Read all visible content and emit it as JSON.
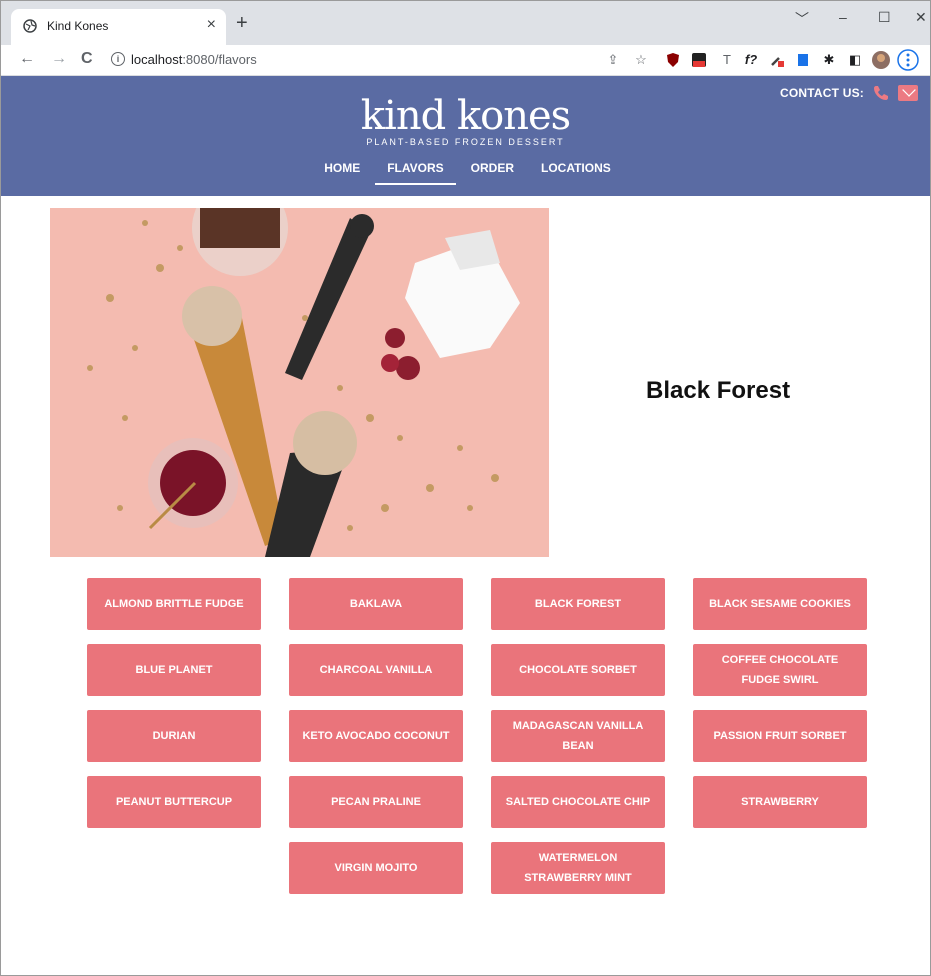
{
  "browser": {
    "tab_title": "Kind Kones",
    "tab_close": "×",
    "new_tab": "+",
    "url_host": "localhost",
    "url_rest": ":8080/flavors",
    "window_controls": [
      "﹀",
      "–",
      "☐",
      "✕"
    ],
    "nav": {
      "back": "←",
      "forward": "→",
      "reload": "C"
    }
  },
  "header": {
    "contact_label": "CONTACT US:",
    "logo_word": "kind kones",
    "logo_tagline": "PLANT-BASED FROZEN DESSERT",
    "nav": [
      {
        "label": "HOME",
        "active": false
      },
      {
        "label": "FLAVORS",
        "active": true
      },
      {
        "label": "ORDER",
        "active": false
      },
      {
        "label": "LOCATIONS",
        "active": false
      }
    ]
  },
  "featured": {
    "title": "Black Forest"
  },
  "flavors": [
    "ALMOND BRITTLE FUDGE",
    "BAKLAVA",
    "BLACK FOREST",
    "BLACK SESAME COOKIES",
    "BLUE PLANET",
    "CHARCOAL VANILLA",
    "CHOCOLATE SORBET",
    "COFFEE CHOCOLATE FUDGE SWIRL",
    "DURIAN",
    "KETO AVOCADO COCONUT",
    "MADAGASCAN VANILLA BEAN",
    "PASSION FRUIT SORBET",
    "PEANUT BUTTERCUP",
    "PECAN PRALINE",
    "SALTED CHOCOLATE CHIP",
    "STRAWBERRY",
    "VIRGIN MOJITO",
    "WATERMELON STRAWBERRY MINT"
  ],
  "colors": {
    "header_bg": "#5a6ba3",
    "button_bg": "#ea747b",
    "accent": "#ec7a83"
  }
}
